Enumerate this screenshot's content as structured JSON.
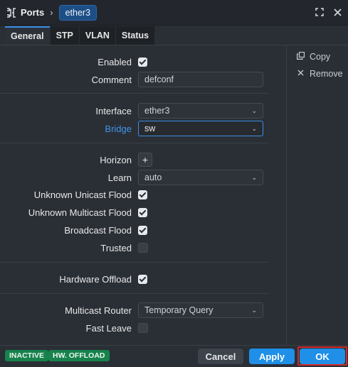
{
  "header": {
    "crumb": "Ports",
    "crumb_sep": "›",
    "item": "ether3",
    "expand_icon": "expand-icon",
    "close_icon": "close-icon"
  },
  "tabs": [
    {
      "label": "General"
    },
    {
      "label": "STP"
    },
    {
      "label": "VLAN"
    },
    {
      "label": "Status"
    }
  ],
  "form": {
    "enabled": {
      "label": "Enabled",
      "checked": true
    },
    "comment": {
      "label": "Comment",
      "value": "defconf"
    },
    "interface": {
      "label": "Interface",
      "value": "ether3"
    },
    "bridge": {
      "label": "Bridge",
      "value": "sw"
    },
    "horizon": {
      "label": "Horizon",
      "button": "+"
    },
    "learn": {
      "label": "Learn",
      "value": "auto"
    },
    "unknown_unicast": {
      "label": "Unknown Unicast Flood",
      "checked": true
    },
    "unknown_multicast": {
      "label": "Unknown Multicast Flood",
      "checked": true
    },
    "broadcast": {
      "label": "Broadcast Flood",
      "checked": true
    },
    "trusted": {
      "label": "Trusted",
      "checked": false
    },
    "hw_offload": {
      "label": "Hardware Offload",
      "checked": true
    },
    "multicast_router": {
      "label": "Multicast Router",
      "value": "Temporary Query"
    },
    "fast_leave": {
      "label": "Fast Leave",
      "checked": false
    }
  },
  "side": {
    "copy": "Copy",
    "remove": "Remove"
  },
  "footer": {
    "badges": [
      "INACTIVE",
      "HW. OFFLOAD"
    ],
    "cancel": "Cancel",
    "apply": "Apply",
    "ok": "OK"
  },
  "colors": {
    "accent": "#1f8fe8",
    "badge": "#17824c",
    "bridge_label": "#3f95e8"
  }
}
